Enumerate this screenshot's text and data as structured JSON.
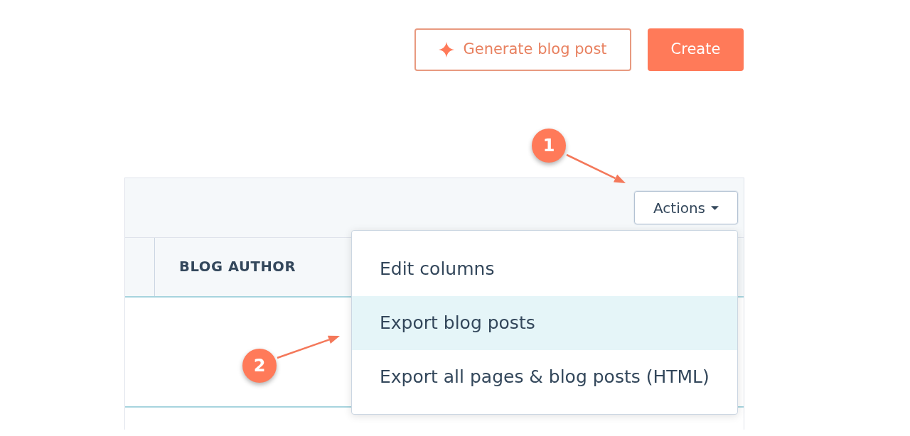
{
  "header_buttons": [
    {
      "label": "Generate blog post",
      "kind": "outline"
    },
    {
      "label": "Create",
      "kind": "primary"
    }
  ],
  "actions_button": {
    "label": "Actions",
    "expanded": true
  },
  "actions_menu": {
    "items": [
      {
        "label": "Edit columns",
        "selected": false
      },
      {
        "label": "Export blog posts",
        "selected": true
      },
      {
        "label": "Export all pages & blog posts (HTML)",
        "selected": false
      }
    ]
  },
  "table": {
    "column_headers": [
      "BLOG AUTHOR"
    ]
  },
  "annotations": [
    {
      "number": "1"
    },
    {
      "number": "2"
    }
  ]
}
